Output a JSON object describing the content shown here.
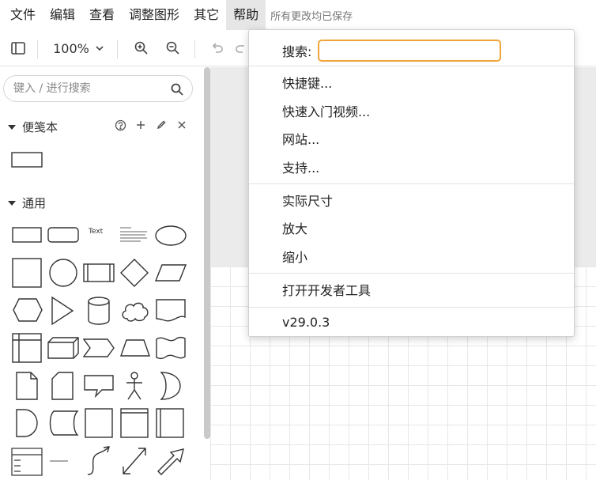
{
  "menubar": {
    "items": [
      "文件",
      "编辑",
      "查看",
      "调整图形",
      "其它",
      "帮助"
    ],
    "save_status": "所有更改均已保存"
  },
  "toolbar": {
    "zoom_level": "100%"
  },
  "sidebar": {
    "search_placeholder": "键入 / 进行搜索",
    "sections": [
      {
        "label": "便笺本",
        "expanded": true
      },
      {
        "label": "通用",
        "expanded": true
      }
    ],
    "shape_text_label": "Text"
  },
  "help_menu": {
    "search_label": "搜索:",
    "search_value": "",
    "items": [
      "快捷键...",
      "快速入门视频...",
      "网站...",
      "支持...",
      "实际尺寸",
      "放大",
      "缩小",
      "打开开发者工具",
      "v29.0.3"
    ]
  },
  "colors": {
    "search_focus_border": "#f2a43a",
    "canvas_top": "#ebebeb",
    "grid_line": "#e7e7e7"
  }
}
